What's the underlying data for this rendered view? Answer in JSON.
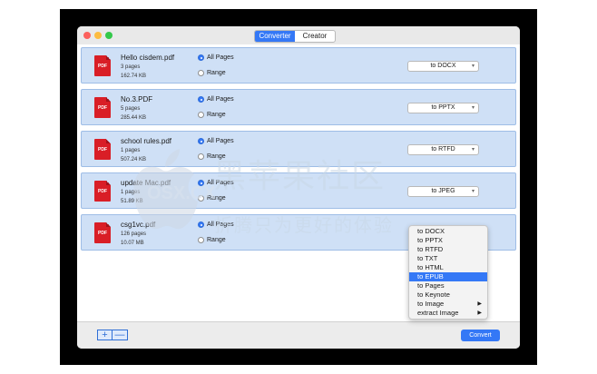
{
  "toolbar": {
    "tabs": [
      {
        "label": "Converter"
      },
      {
        "label": "Creator"
      }
    ]
  },
  "files": [
    {
      "name": "Hello cisdem.pdf",
      "pages": "3 pages",
      "size": "162.74 KB",
      "all_pages": "All Pages",
      "range": "Range",
      "format": "to DOCX"
    },
    {
      "name": "No.3.PDF",
      "pages": "5 pages",
      "size": "285.44 KB",
      "all_pages": "All Pages",
      "range": "Range",
      "format": "to PPTX"
    },
    {
      "name": "school rules.pdf",
      "pages": "1 pages",
      "size": "507.24 KB",
      "all_pages": "All Pages",
      "range": "Range",
      "format": "to RTFD"
    },
    {
      "name": "update Mac.pdf",
      "pages": "1 pages",
      "size": "51.89 KB",
      "all_pages": "All Pages",
      "range": "Range",
      "format": "to JPEG"
    },
    {
      "name": "csg1vc.pdf",
      "pages": "126 pages",
      "size": "10.07 MB",
      "all_pages": "All Pages",
      "range": "Range",
      "format": ""
    }
  ],
  "pdf_icon_label": "PDF",
  "dropdown": {
    "items": [
      {
        "label": "to DOCX"
      },
      {
        "label": "to PPTX"
      },
      {
        "label": "to RTFD"
      },
      {
        "label": "to TXT"
      },
      {
        "label": "to HTML"
      },
      {
        "label": "to EPUB"
      },
      {
        "label": "to Pages"
      },
      {
        "label": "to Keynote"
      },
      {
        "label": "to Image"
      },
      {
        "label": "extract Image"
      }
    ],
    "highlighted": "to EPUB"
  },
  "bottom": {
    "add": "+",
    "remove": "—",
    "convert": "Convert"
  },
  "watermark": {
    "title": "黑苹果社区",
    "subtitle": "折腾只为更好的体验",
    "domain": "OSX.CX"
  },
  "colors": {
    "accent": "#3478f6",
    "row_bg": "#cfe0f6",
    "pdf_red": "#d91e26"
  }
}
